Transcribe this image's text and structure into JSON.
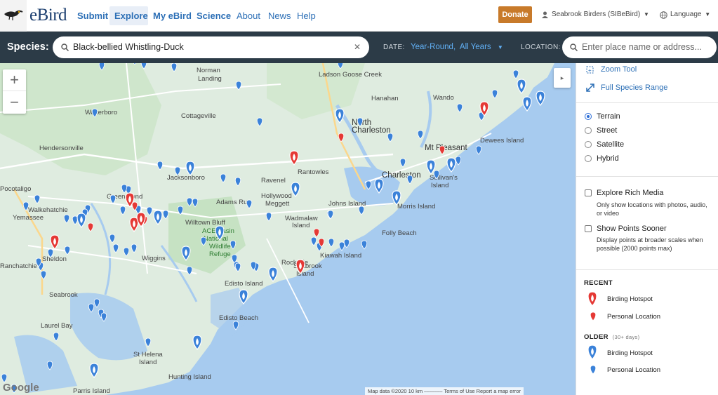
{
  "nav": {
    "logo": "eBird",
    "links": [
      "Submit",
      "Explore",
      "My eBird",
      "Science",
      "About",
      "News",
      "Help"
    ],
    "donate": "Donate",
    "user": "Seabrook Birders (SIBeBird)",
    "language": "Language"
  },
  "species_bar": {
    "label": "Species:",
    "species_value": "Black-bellied Whistling-Duck",
    "clear": "✕",
    "date_label": "DATE:",
    "date_value": "Year-Round,  All Years",
    "location_label": "LOCATION:",
    "location_placeholder": "Enter place name or address..."
  },
  "map": {
    "zoom_in": "+",
    "zoom_out": "−",
    "collapse": "▸",
    "google": "Google",
    "attribution": "Map data ©2020   10 km ⎯⎯⎯⎯⎯⎯⎯   Terms of Use   Report a map error",
    "places": [
      "Ladson",
      "Goose Creek",
      "Hanahan",
      "Wando",
      "Norman",
      "Landing",
      "Walterboro",
      "Cottageville",
      "North",
      "Charleston",
      "Mt Pleasant",
      "Dewees Island",
      "Hendersonville",
      "Jacksonboro",
      "Ravenel",
      "Rantowles",
      "Charleston",
      "Sullivan's",
      "Island",
      "Hollywood",
      "Meggett",
      "Green Pond",
      "Adams Run",
      "Johns Island",
      "Morris Island",
      "Yemassee",
      "Walkehatchie",
      "Willtown Bluff",
      "ACE Basin",
      "National",
      "Wildlife",
      "Refuge",
      "Wadmalaw",
      "Island",
      "Folly Beach",
      "Wiggins",
      "Rockville",
      "Seabrook",
      "Island",
      "Kiawah Island",
      "Edisto Island",
      "Edisto Beach",
      "Seabrook",
      "Laurel Bay",
      "St Helena",
      "Island",
      "Hunting Island",
      "Parris Island",
      "Sheldon",
      "Pocotaligo",
      "Ranchatchie"
    ]
  },
  "panel": {
    "zoom_tool": "Zoom Tool",
    "full_range": "Full Species Range",
    "map_types": [
      {
        "label": "Terrain",
        "selected": true
      },
      {
        "label": "Street",
        "selected": false
      },
      {
        "label": "Satellite",
        "selected": false
      },
      {
        "label": "Hybrid",
        "selected": false
      }
    ],
    "rich_media_label": "Explore Rich Media",
    "rich_media_desc": "Only show locations with photos, audio, or video",
    "sooner_label": "Show Points Sooner",
    "sooner_desc": "Display points at broader scales when possible (2000 points max)",
    "recent_heading": "RECENT",
    "older_heading": "OLDER",
    "older_sub": "(30+ days)",
    "hotspot": "Birding Hotspot",
    "personal": "Personal Location"
  },
  "colors": {
    "recent": "#e53935",
    "older": "#3b82d9",
    "nav_link": "#2c6fb6",
    "bar": "#2c3b47",
    "donate": "#c87a2a"
  },
  "icons": [
    "bird-logo-icon",
    "user-icon",
    "globe-icon",
    "caret-down-icon",
    "search-icon",
    "zoom-tool-icon",
    "expand-icon"
  ]
}
